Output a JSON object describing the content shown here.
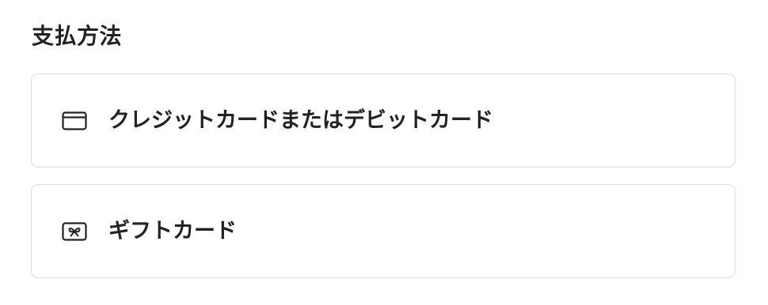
{
  "section": {
    "title": "支払方法"
  },
  "payment_options": [
    {
      "label": "クレジットカードまたはデビットカード",
      "icon": "credit-card-icon"
    },
    {
      "label": "ギフトカード",
      "icon": "gift-card-icon"
    }
  ],
  "colors": {
    "text": "#222222",
    "border": "#dddddd",
    "background": "#ffffff"
  }
}
